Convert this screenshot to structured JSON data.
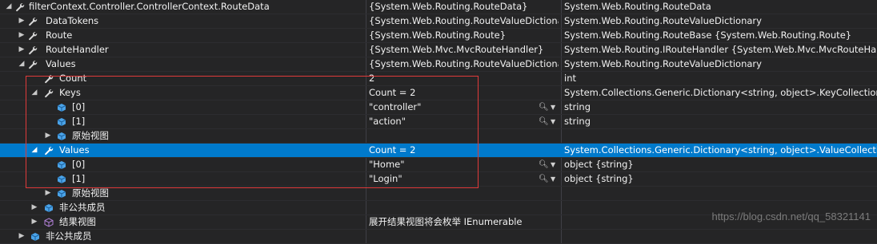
{
  "rows": [
    {
      "name": "filterContext.Controller.ControllerContext.RouteData",
      "value": "{System.Web.Routing.RouteData}",
      "type": "System.Web.Routing.RouteData"
    },
    {
      "name": "DataTokens",
      "value": "{System.Web.Routing.RouteValueDictionary}",
      "type": "System.Web.Routing.RouteValueDictionary"
    },
    {
      "name": "Route",
      "value": "{System.Web.Routing.Route}",
      "type": "System.Web.Routing.RouteBase {System.Web.Routing.Route}"
    },
    {
      "name": "RouteHandler",
      "value": "{System.Web.Mvc.MvcRouteHandler}",
      "type": "System.Web.Routing.IRouteHandler {System.Web.Mvc.MvcRouteHandler}"
    },
    {
      "name": "Values",
      "value": "{System.Web.Routing.RouteValueDictionary}",
      "type": "System.Web.Routing.RouteValueDictionary"
    },
    {
      "name": "Count",
      "value": "2",
      "type": "int"
    },
    {
      "name": "Keys",
      "value": "Count = 2",
      "type": "System.Collections.Generic.Dictionary<string, object>.KeyCollection"
    },
    {
      "name": "[0]",
      "value": "\"controller\"",
      "type": "string"
    },
    {
      "name": "[1]",
      "value": "\"action\"",
      "type": "string"
    },
    {
      "name": "原始视图",
      "value": "",
      "type": ""
    },
    {
      "name": "Values",
      "value": "Count = 2",
      "type": "System.Collections.Generic.Dictionary<string, object>.ValueCollection"
    },
    {
      "name": "[0]",
      "value": "\"Home\"",
      "type": "object {string}"
    },
    {
      "name": "[1]",
      "value": "\"Login\"",
      "type": "object {string}"
    },
    {
      "name": "原始视图",
      "value": "",
      "type": ""
    },
    {
      "name": "非公共成员",
      "value": "",
      "type": ""
    },
    {
      "name": "结果视图",
      "value": "展开结果视图将会枚举 IEnumerable",
      "type": ""
    },
    {
      "name": "非公共成员",
      "value": "",
      "type": ""
    }
  ],
  "watermark": "https://blog.csdn.net/qq_58321141",
  "colors": {
    "background": "#252526",
    "selection": "#007acc",
    "highlight_box": "#e03a3a"
  }
}
